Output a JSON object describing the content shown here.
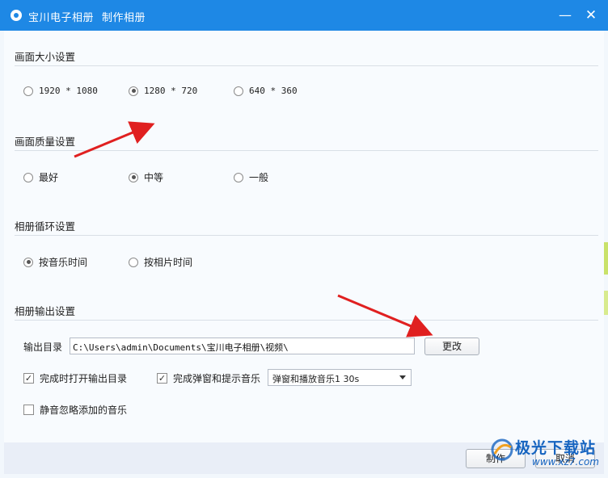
{
  "window": {
    "app_name": "宝川电子相册",
    "dialog_title": "制作相册",
    "minimize_glyph": "—",
    "close_glyph": "✕"
  },
  "sections": {
    "size": {
      "title": "画面大小设置",
      "options": [
        "1920 * 1080",
        "1280 * 720",
        "640 * 360"
      ],
      "selected": 1
    },
    "quality": {
      "title": "画面质量设置",
      "options": [
        "最好",
        "中等",
        "一般"
      ],
      "selected": 1
    },
    "loop": {
      "title": "相册循环设置",
      "options": [
        "按音乐时间",
        "按相片时间"
      ],
      "selected": 0
    },
    "output": {
      "title": "相册输出设置",
      "dir_label": "输出目录",
      "dir_value": "C:\\Users\\admin\\Documents\\宝川电子相册\\视频\\",
      "change_button": "更改",
      "open_dir_label": "完成时打开输出目录",
      "open_dir_checked": true,
      "popup_label": "完成弹窗和提示音乐",
      "popup_checked": true,
      "popup_select_value": "弹窗和播放音乐1  30s",
      "mute_label": "静音忽略添加的音乐",
      "mute_checked": false
    }
  },
  "footer": {
    "make_button": "制作",
    "cancel_button": "取消"
  },
  "watermark": {
    "text": "极光下载站",
    "url": "www.xz7.com"
  },
  "colors": {
    "titlebar": "#1e88e5",
    "arrow": "#e02020",
    "watermark": "#1664c0"
  }
}
